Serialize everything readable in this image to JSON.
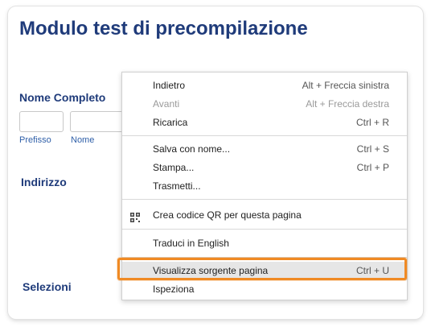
{
  "form": {
    "title": "Modulo test di precompilazione",
    "name_section": "Nome Completo",
    "prefix_label": "Prefisso",
    "name_label": "Nome",
    "address_section": "Indirizzo",
    "selections_section": "Selezioni"
  },
  "context_menu": {
    "items": [
      {
        "label": "Indietro",
        "shortcut": "Alt + Freccia sinistra",
        "disabled": false
      },
      {
        "label": "Avanti",
        "shortcut": "Alt + Freccia destra",
        "disabled": true
      },
      {
        "label": "Ricarica",
        "shortcut": "Ctrl + R",
        "disabled": false
      },
      {
        "label": "Salva con nome...",
        "shortcut": "Ctrl + S",
        "disabled": false
      },
      {
        "label": "Stampa...",
        "shortcut": "Ctrl + P",
        "disabled": false
      },
      {
        "label": "Trasmetti...",
        "shortcut": "",
        "disabled": false
      },
      {
        "label": "Crea codice QR per questa pagina",
        "shortcut": "",
        "disabled": false,
        "icon": "qr-code-icon"
      },
      {
        "label": "Traduci in English",
        "shortcut": "",
        "disabled": false
      },
      {
        "label": "Visualizza sorgente pagina",
        "shortcut": "Ctrl + U",
        "disabled": false,
        "highlighted": true
      },
      {
        "label": "Ispeziona",
        "shortcut": "",
        "disabled": false
      }
    ]
  },
  "colors": {
    "title": "#1f3b7a",
    "highlight_border": "#f08a24",
    "selected_item_bg": "#e6e6e6"
  }
}
